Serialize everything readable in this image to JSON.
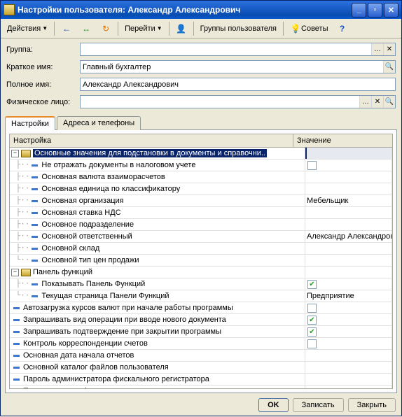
{
  "window": {
    "title": "Настройки пользователя: Александр Александрович"
  },
  "toolbar": {
    "actions": "Действия",
    "goto": "Перейти",
    "groups": "Группы пользователя",
    "tips": "Советы"
  },
  "form": {
    "group_label": "Группа:",
    "group_value": "",
    "short_label": "Краткое имя:",
    "short_value": "Главный бухгалтер",
    "full_label": "Полное имя:",
    "full_value": "Александр Александрович",
    "phys_label": "Физическое лицо:",
    "phys_value": ""
  },
  "tabs": {
    "t1": "Настройки",
    "t2": "Адреса и телефоны"
  },
  "table": {
    "col1": "Настройка",
    "col2": "Значение",
    "rows": [
      {
        "type": "folder",
        "level": 0,
        "label": "Основные значения для подстановки в документы и справочни..",
        "value": "",
        "selected": true
      },
      {
        "type": "leaf",
        "level": 1,
        "label": "Не отражать документы в налоговом учете",
        "value_type": "check",
        "checked": false
      },
      {
        "type": "leaf",
        "level": 1,
        "label": "Основная валюта взаиморасчетов",
        "value": ""
      },
      {
        "type": "leaf",
        "level": 1,
        "label": "Основная единица по классификатору",
        "value": ""
      },
      {
        "type": "leaf",
        "level": 1,
        "label": "Основная организация",
        "value": "Мебельщик"
      },
      {
        "type": "leaf",
        "level": 1,
        "label": "Основная ставка НДС",
        "value": ""
      },
      {
        "type": "leaf",
        "level": 1,
        "label": "Основное подразделение",
        "value": ""
      },
      {
        "type": "leaf",
        "level": 1,
        "label": "Основной ответственный",
        "value": "Александр Александрович"
      },
      {
        "type": "leaf",
        "level": 1,
        "label": "Основной склад",
        "value": ""
      },
      {
        "type": "leaf",
        "level": 1,
        "label": "Основной тип цен продажи",
        "value": "",
        "last": true
      },
      {
        "type": "folder",
        "level": 0,
        "label": "Панель функций",
        "value": ""
      },
      {
        "type": "leaf",
        "level": 1,
        "label": "Показывать Панель Функций",
        "value_type": "check",
        "checked": true
      },
      {
        "type": "leaf",
        "level": 1,
        "label": "Текущая страница Панели Функций",
        "value": "Предприятие",
        "last": true
      },
      {
        "type": "leaf",
        "level": 0,
        "label": "Автозагрузка курсов валют при начале работы программы",
        "value_type": "check",
        "checked": false
      },
      {
        "type": "leaf",
        "level": 0,
        "label": "Запрашивать вид операции при вводе нового документа",
        "value_type": "check",
        "checked": true
      },
      {
        "type": "leaf",
        "level": 0,
        "label": "Запрашивать подтверждение при закрытии программы",
        "value_type": "check",
        "checked": true
      },
      {
        "type": "leaf",
        "level": 0,
        "label": "Контроль корреспонденции счетов",
        "value_type": "check",
        "checked": false
      },
      {
        "type": "leaf",
        "level": 0,
        "label": "Основная дата начала отчетов",
        "value": ""
      },
      {
        "type": "leaf",
        "level": 0,
        "label": "Основной каталог файлов пользователя",
        "value": ""
      },
      {
        "type": "leaf",
        "level": 0,
        "label": "Пароль администратора фискального регистратора",
        "value": ""
      },
      {
        "type": "leaf",
        "level": 0,
        "label": "Пароль кассира фискального регистратора",
        "value": ""
      }
    ]
  },
  "footer": {
    "ok": "OK",
    "write": "Записать",
    "close": "Закрыть"
  }
}
